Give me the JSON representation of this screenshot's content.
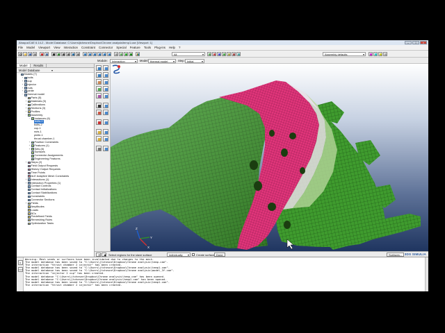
{
  "window": {
    "title": "Abaqus/CAE 6.14-2 - Model Database: C:\\Users\\jtchesne\\Dropbox\\Chrome analysis\\temp1.cae [Viewport: 1]",
    "controls": [
      "–",
      "□",
      "×"
    ]
  },
  "menu": [
    "File",
    "Model",
    "Viewport",
    "View",
    "Interaction",
    "Constraint",
    "Connector",
    "Special",
    "Feature",
    "Tools",
    "Plug-ins",
    "Help",
    "?"
  ],
  "toolbar": {
    "display_combo": "All",
    "assembly_combo": "Assembly defaults"
  },
  "context": {
    "module_label": "Module:",
    "module_value": "Interaction",
    "model_label": "Model:",
    "model_value": "thermal model",
    "step_label": "Step:",
    "step_value": "Initial"
  },
  "tree": {
    "tabs": [
      "Model",
      "Results"
    ],
    "header": "Model Database",
    "nodes": [
      {
        "indent": 0,
        "toggle": "−",
        "label": "Models (7)",
        "icon": "b"
      },
      {
        "indent": 1,
        "toggle": "+",
        "label": "bolts",
        "icon": "b"
      },
      {
        "indent": 1,
        "toggle": "+",
        "label": "cup",
        "icon": "b"
      },
      {
        "indent": 1,
        "toggle": "+",
        "label": "injector",
        "icon": "b"
      },
      {
        "indent": 1,
        "toggle": "+",
        "label": "nuts",
        "icon": "b"
      },
      {
        "indent": 1,
        "toggle": "+",
        "label": "pintle",
        "icon": "b"
      },
      {
        "indent": 1,
        "toggle": "−",
        "label": "thermal model",
        "icon": "b"
      },
      {
        "indent": 2,
        "toggle": "+",
        "label": "Parts (5)",
        "icon": "y"
      },
      {
        "indent": 2,
        "toggle": "+",
        "label": "Materials (5)",
        "icon": "y"
      },
      {
        "indent": 2,
        "toggle": "+",
        "label": "Calibrations",
        "icon": "y"
      },
      {
        "indent": 2,
        "toggle": "+",
        "label": "Sections (3)",
        "icon": "y"
      },
      {
        "indent": 2,
        "toggle": "+",
        "label": "Profiles",
        "icon": "y"
      },
      {
        "indent": 2,
        "toggle": "−",
        "label": "Assembly",
        "icon": "g"
      },
      {
        "indent": 3,
        "toggle": "−",
        "label": "Instances (6)",
        "icon": "g"
      },
      {
        "indent": 4,
        "toggle": "",
        "label": "bolts-1",
        "icon": "",
        "selected": true
      },
      {
        "indent": 4,
        "toggle": "",
        "label": "bolts-2",
        "icon": ""
      },
      {
        "indent": 4,
        "toggle": "",
        "label": "cup-1",
        "icon": ""
      },
      {
        "indent": 4,
        "toggle": "",
        "label": "nuts-1",
        "icon": ""
      },
      {
        "indent": 4,
        "toggle": "",
        "label": "pintle-1",
        "icon": ""
      },
      {
        "indent": 4,
        "toggle": "",
        "label": "thrust chamber-1",
        "icon": ""
      },
      {
        "indent": 3,
        "toggle": "+",
        "label": "Position Constraints",
        "icon": "g"
      },
      {
        "indent": 3,
        "toggle": "+",
        "label": "Features (1)",
        "icon": "g"
      },
      {
        "indent": 3,
        "toggle": "+",
        "label": "Sets (8)",
        "icon": "g"
      },
      {
        "indent": 3,
        "toggle": "",
        "label": "Surfaces",
        "icon": "g"
      },
      {
        "indent": 3,
        "toggle": "",
        "label": "Connector Assignments",
        "icon": "g"
      },
      {
        "indent": 3,
        "toggle": "",
        "label": "Engineering Features",
        "icon": "g"
      },
      {
        "indent": 2,
        "toggle": "+",
        "label": "Steps (2)",
        "icon": "r"
      },
      {
        "indent": 2,
        "toggle": "",
        "label": "Field Output Requests",
        "icon": "r"
      },
      {
        "indent": 2,
        "toggle": "",
        "label": "History Output Requests",
        "icon": "r"
      },
      {
        "indent": 2,
        "toggle": "",
        "label": "Time Points",
        "icon": "r"
      },
      {
        "indent": 2,
        "toggle": "",
        "label": "ALE Adaptive Mesh Constraints",
        "icon": "r"
      },
      {
        "indent": 2,
        "toggle": "+",
        "label": "Interactions (1)",
        "icon": "b"
      },
      {
        "indent": 2,
        "toggle": "+",
        "label": "Interaction Properties (1)",
        "icon": "b"
      },
      {
        "indent": 2,
        "toggle": "",
        "label": "Contact Controls",
        "icon": "b"
      },
      {
        "indent": 2,
        "toggle": "",
        "label": "Contact Initializations",
        "icon": "b"
      },
      {
        "indent": 2,
        "toggle": "",
        "label": "Contact Stabilizations",
        "icon": "b"
      },
      {
        "indent": 2,
        "toggle": "",
        "label": "Constraints",
        "icon": "b"
      },
      {
        "indent": 2,
        "toggle": "",
        "label": "Connector Sections",
        "icon": "b"
      },
      {
        "indent": 2,
        "toggle": "+",
        "label": "Fields",
        "icon": "y"
      },
      {
        "indent": 2,
        "toggle": "",
        "label": "Amplitudes",
        "icon": "y"
      },
      {
        "indent": 2,
        "toggle": "",
        "label": "Loads",
        "icon": "y"
      },
      {
        "indent": 2,
        "toggle": "",
        "label": "BCs",
        "icon": "y"
      },
      {
        "indent": 2,
        "toggle": "",
        "label": "Predefined Fields",
        "icon": "y"
      },
      {
        "indent": 2,
        "toggle": "",
        "label": "Remeshing Rules",
        "icon": "y"
      },
      {
        "indent": 2,
        "toggle": "",
        "label": "Optimization Tasks",
        "icon": "y"
      }
    ]
  },
  "prompt": {
    "text": "Select regions for the slave surface",
    "mode_value": "individually",
    "create_label": "Create surface:",
    "done_label": "Done",
    "surfaces_btn": "Surfaces...",
    "brand": "3DS SIMULIA"
  },
  "messages": [
    "Warning: Mesh seeds or surfaces have been invalidated due to changes to the mesh.",
    "The model database has been saved to \"C:\\Users\\jtchesne\\Dropbox\\Chrome analysis\\temp.cae\".",
    "The interaction \"thrust chamber 2 injector\" has been created.",
    "The model database has been saved to \"C:\\Users\\jtchesne\\Dropbox\\Chrome analysis\\temp1.cae\".",
    "The model database has been saved to \"C:\\Users\\jtchesne\\Dropbox\\Chrome analysis\\model_3f.cae\".",
    "The interaction \"injector 2 cup\" has been created.",
    "The model database \"C:\\Users\\jtchesne\\Dropbox\\Chrome analysis\\temp.cae\" has been opened.",
    "The model database \"C:\\Users\\jtchesne\\Dropbox\\Chrome analysis\\temp1.cae\" has been opened.",
    "The model database has been saved to \"C:\\Users\\jtchesne\\Dropbox\\Chrome analysis\\temp1.cae\".",
    "The interaction \"thrust chamber 2 injector\" has been created."
  ],
  "colors": {
    "mesh_green": "#3f9b2e",
    "mesh_pink": "#e0357a",
    "mesh_line": "#123d10",
    "selection": "#3377cc"
  }
}
